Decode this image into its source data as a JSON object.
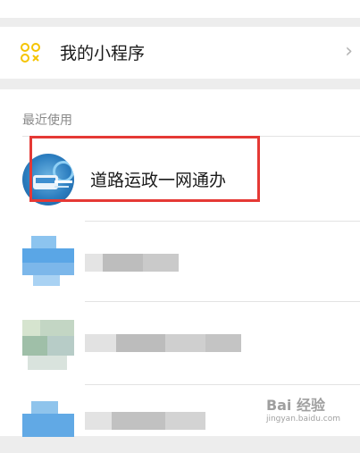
{
  "my_mini_programs": {
    "label": "我的小程序",
    "chevron": "›"
  },
  "recent": {
    "section_label": "最近使用",
    "items": [
      {
        "name": "道路运政一网通办"
      }
    ]
  },
  "watermark": {
    "text": "Bai 经验",
    "sub": "jingyan.baidu.com"
  },
  "colors": {
    "highlight": "#e53935",
    "icon_accent": "#f5c400",
    "background": "#ededed"
  }
}
